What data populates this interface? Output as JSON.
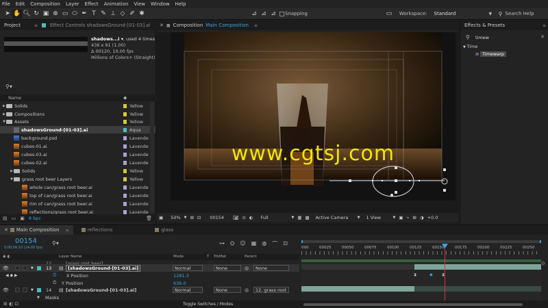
{
  "menu": [
    "File",
    "Edit",
    "Composition",
    "Layer",
    "Effect",
    "Animation",
    "View",
    "Window",
    "Help"
  ],
  "toolbar": {
    "snapping": "Snapping",
    "workspace_label": "Workspace:",
    "workspace_value": "Standard",
    "search_help": "Search Help"
  },
  "project_panel": {
    "tab": "Project",
    "effect_controls_tab": "Effect Controls shadowsGround-[01-03].ai",
    "asset_name": "shadows...i ▾",
    "asset_used": ", used 4 times",
    "asset_dims": "436 x 91 (1.00)",
    "asset_fps": "Δ 00120, 10.00 fps",
    "asset_colors": "Millions of Colors+ (Straight)",
    "col_name": "Name",
    "bpc": "8 bpc",
    "items": [
      {
        "name": "Solids",
        "label": "Yellow"
      },
      {
        "name": "Compositions",
        "label": "Yellow"
      },
      {
        "name": "Assets",
        "label": "Yellow"
      },
      {
        "name": "shadowsGround-[01-03].ai",
        "label": "Aqua"
      },
      {
        "name": "background.psd",
        "label": "Lavende"
      },
      {
        "name": "cubes-01.ai",
        "label": "Lavende"
      },
      {
        "name": "cubes-03.ai",
        "label": "Lavende"
      },
      {
        "name": "cubes-02.ai",
        "label": "Lavende"
      },
      {
        "name": "Solids",
        "label": "Yellow"
      },
      {
        "name": "grass root beer Layers",
        "label": "Yellow"
      },
      {
        "name": "whole can/grass root beer.ai",
        "label": "Lavende"
      },
      {
        "name": "top of can/grass root beer.ai",
        "label": "Lavende"
      },
      {
        "name": "rim of can/grass root beer.ai",
        "label": "Lavende"
      },
      {
        "name": "reflections/grass root beer.ai",
        "label": "Lavende"
      }
    ]
  },
  "composition": {
    "tab_prefix": "Composition",
    "tab_name": "Main Composition",
    "watermark": "www.cgtsj.com",
    "zoom": "50%",
    "timecode": "00154",
    "resolution": "Full",
    "camera": "Active Camera",
    "views": "1 View"
  },
  "effects_presets": {
    "tab": "Effects & Presets",
    "search_value": "timew",
    "category": "Time",
    "effect": "Timewarp"
  },
  "timeline": {
    "tabs": [
      "Main Composition",
      "reflections",
      "glass"
    ],
    "current_time": "00154",
    "time_sub": "0:00:06:10 (24.00 fps)",
    "col_layer_name": "Layer Name",
    "col_mode": "Mode",
    "col_t": "T",
    "col_trkmat": "TrkMat",
    "col_parent": "Parent",
    "ruler": [
      "000",
      "00025",
      "00050",
      "00075",
      "00100",
      "00125",
      "00150",
      "00175",
      "00200",
      "00225",
      "00250"
    ],
    "layers": [
      {
        "num": "12",
        "name": "[grass root beer]",
        "mode": "",
        "trkmat": "",
        "parent": ""
      },
      {
        "num": "13",
        "name": "[shadowsGround-[01-03].ai]",
        "mode": "Normal",
        "trkmat": "None",
        "parent": "None"
      },
      {
        "num": "14",
        "name": "[shadowsGround-[01-03].ai]",
        "mode": "Normal",
        "trkmat": "None",
        "parent": "12. grass root"
      }
    ],
    "props": [
      {
        "name": "X Position",
        "value": "1281.3"
      },
      {
        "name": "Y Position",
        "value": "636.0"
      }
    ],
    "masks": "Masks",
    "toggle": "Toggle Switches / Modes"
  },
  "colors": {
    "accent_blue": "#3aa3e0",
    "watermark_yellow": "#f2e600",
    "label_yellow": "#d8c83a",
    "label_aqua": "#4fbcc0",
    "label_lavender": "#a9a3d8"
  }
}
